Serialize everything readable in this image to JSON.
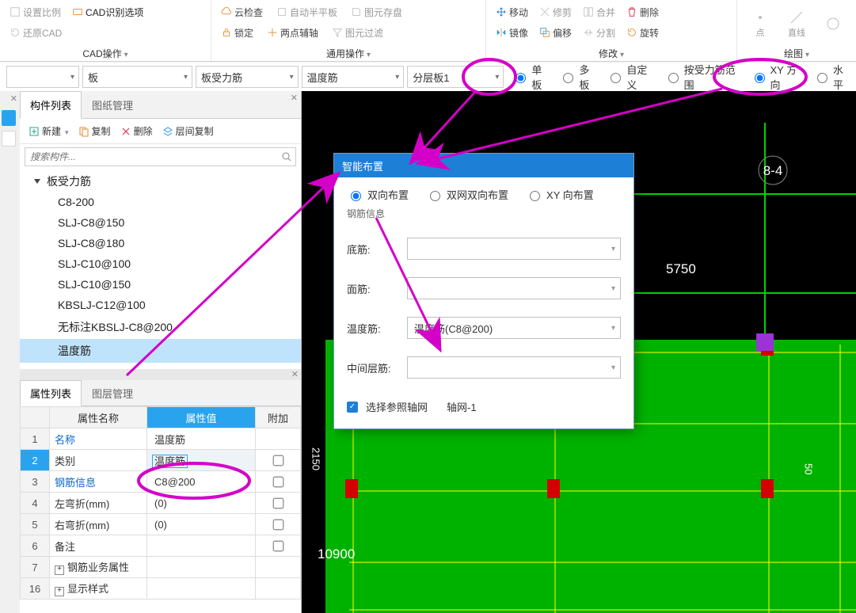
{
  "ribbon": {
    "cad": {
      "title": "CAD操作",
      "btns": [
        "设置比例",
        "CAD识别选项",
        "还原CAD"
      ]
    },
    "cloud": {
      "btn": "云检查",
      "lock": "锁定",
      "half": "自动半平板",
      "two": "两点辅轴"
    },
    "disk": {
      "save": "图元存盘",
      "filter": "图元过滤"
    },
    "general": {
      "title": "通用操作"
    },
    "modify": {
      "title": "修改",
      "move": "移动",
      "trim": "修剪",
      "merge": "合并",
      "del": "删除",
      "mirror": "镜像",
      "offset": "偏移",
      "split": "分割",
      "rotate": "旋转"
    },
    "draw": {
      "title": "绘图",
      "pt": "点",
      "ln": "直线"
    }
  },
  "optbar": {
    "s1": "",
    "s2": "板",
    "s3": "板受力筋",
    "s4": "温度筋",
    "s5": "分层板1",
    "r1": "单板",
    "r2": "多板",
    "r3": "自定义",
    "r4": "按受力筋范围",
    "r5": "XY 方向",
    "r6": "水平"
  },
  "comp": {
    "tabs": {
      "t1": "构件列表",
      "t2": "图纸管理"
    },
    "tbtns": {
      "new": "新建",
      "copy": "复制",
      "del": "删除",
      "inter": "层间复制"
    },
    "search_ph": "搜索构件...",
    "root": "板受力筋",
    "items": [
      "C8-200",
      "SLJ-C8@150",
      "SLJ-C8@180",
      "SLJ-C10@100",
      "SLJ-C10@150",
      "KBSLJ-C12@100",
      "无标注KBSLJ-C8@200",
      "温度筋"
    ]
  },
  "prop": {
    "tabs": {
      "t1": "属性列表",
      "t2": "图层管理"
    },
    "headers": {
      "k": "属性名称",
      "v": "属性值",
      "a": "附加"
    },
    "rows": [
      {
        "n": "1",
        "k": "名称",
        "v": "温度筋",
        "blue": true
      },
      {
        "n": "2",
        "k": "类别",
        "v": "温度筋",
        "sel": true
      },
      {
        "n": "3",
        "k": "钢筋信息",
        "v": "C8@200",
        "blue": true
      },
      {
        "n": "4",
        "k": "左弯折(mm)",
        "v": "(0)"
      },
      {
        "n": "5",
        "k": "右弯折(mm)",
        "v": "(0)"
      },
      {
        "n": "6",
        "k": "备注",
        "v": ""
      },
      {
        "n": "7",
        "k": "钢筋业务属性",
        "v": "",
        "exp": true
      },
      {
        "n": "16",
        "k": "显示样式",
        "v": "",
        "exp": true
      }
    ]
  },
  "dialog": {
    "title": "智能布置",
    "radios": {
      "r1": "双向布置",
      "r2": "双网双向布置",
      "r3": "XY 向布置"
    },
    "section": "钢筋信息",
    "rows": {
      "bot": {
        "lbl": "底筋:",
        "val": ""
      },
      "top": {
        "lbl": "面筋:",
        "val": ""
      },
      "temp": {
        "lbl": "温度筋:",
        "val": "温度筋(C8@200)"
      },
      "mid": {
        "lbl": "中间层筋:",
        "val": ""
      }
    },
    "ref": {
      "lbl": "选择参照轴网",
      "val": "轴网-1"
    }
  },
  "canvas": {
    "lbl1": "8-4",
    "lbl2": "5750",
    "lbl3": "10900"
  }
}
